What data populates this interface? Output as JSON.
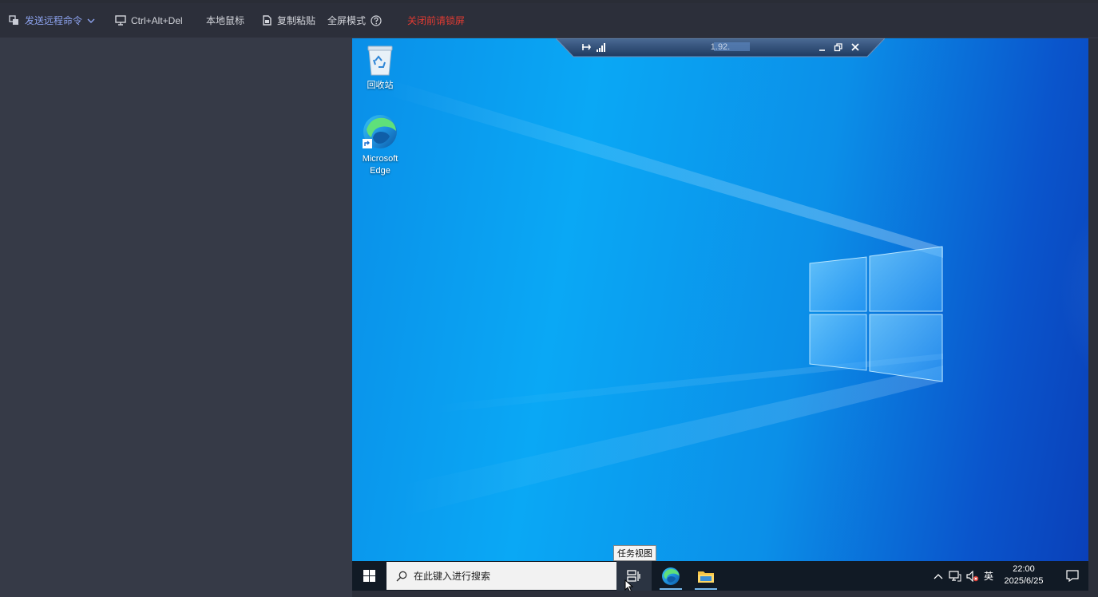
{
  "toolbar": {
    "send_command": "发送远程命令",
    "ctrl_alt_del": "Ctrl+Alt+Del",
    "local_mouse": "本地鼠标",
    "copy_paste": "复制粘贴",
    "fullscreen": "全屏模式",
    "lock_screen": "关闭前请锁屏",
    "send_color": "#8ea4f0",
    "lock_color": "#e23b32"
  },
  "connection_bar": {
    "ip": "1.92."
  },
  "desktop": {
    "icons": [
      {
        "label": "回收站",
        "icon": "recycle-bin-icon"
      },
      {
        "label": "Microsoft\nEdge",
        "label_line1": "Microsoft",
        "label_line2": "Edge",
        "icon": "edge-icon"
      }
    ]
  },
  "taskbar": {
    "search_placeholder": "在此键入进行搜索",
    "tooltip": "任务视图",
    "ime": "英",
    "time": "22:00",
    "date": "2025/6/25"
  }
}
